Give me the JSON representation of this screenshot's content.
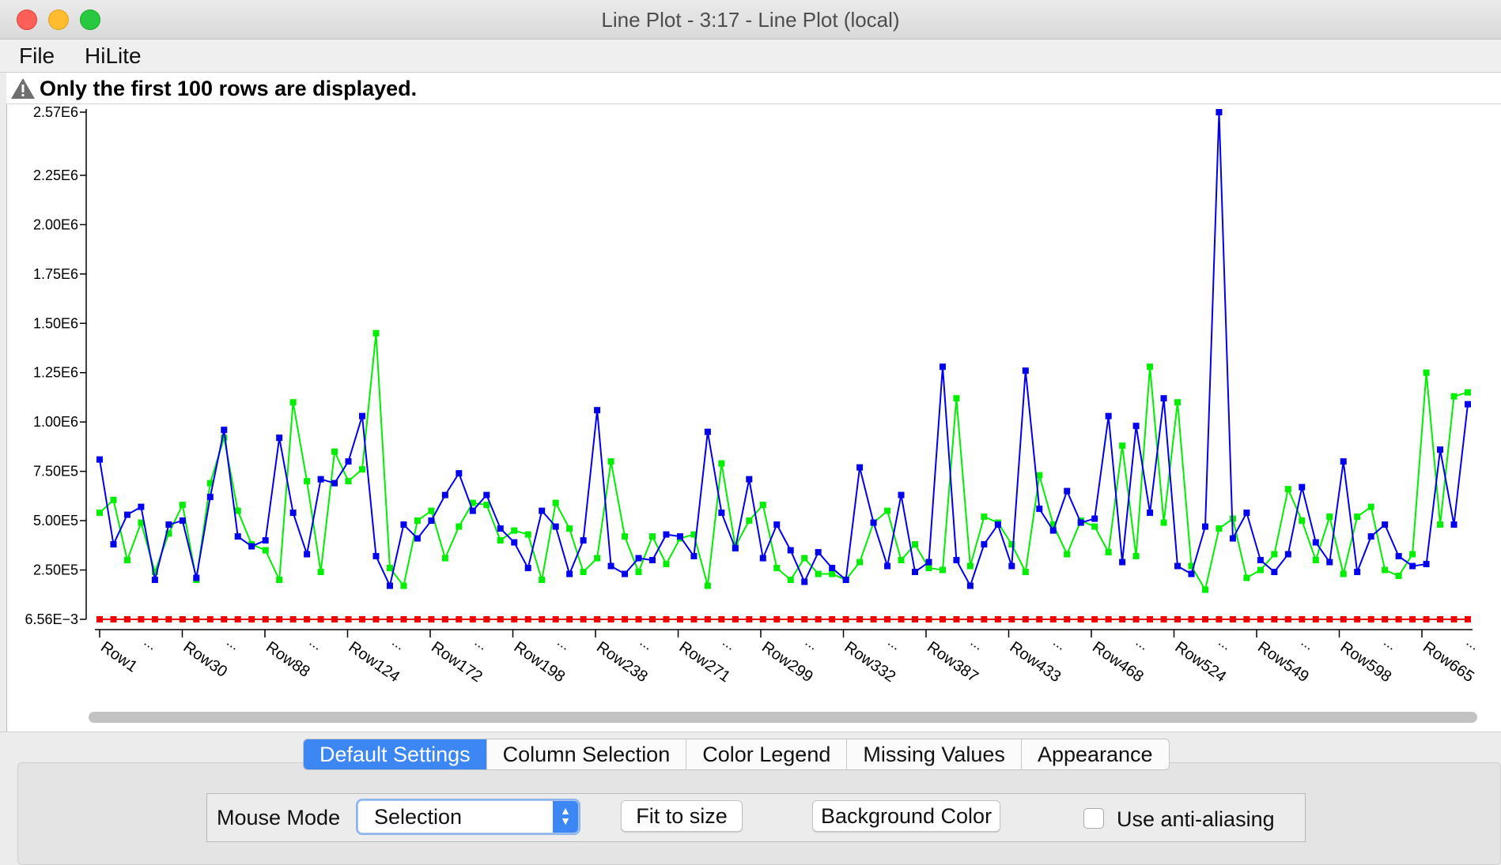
{
  "window": {
    "title": "Line Plot - 3:17 - Line Plot (local)"
  },
  "menu": [
    "File",
    "HiLite"
  ],
  "notice": {
    "text": "Only the first 100 rows are displayed.",
    "icon": "warning-icon"
  },
  "chart_data": {
    "type": "line",
    "title": "",
    "xlabel": "",
    "ylabel": "",
    "ylim": [
      0.00656,
      2570000
    ],
    "y_ticks": [
      "6.56E−3",
      "2.50E5",
      "5.00E5",
      "7.50E5",
      "1.00E6",
      "1.25E6",
      "1.50E6",
      "1.75E6",
      "2.00E6",
      "2.25E6",
      "2.57E6"
    ],
    "y_tick_values": [
      0.00656,
      250000,
      500000,
      750000,
      1000000,
      1250000,
      1500000,
      1750000,
      2000000,
      2250000,
      2570000
    ],
    "x_tick_labels": [
      "Row1",
      "Row30",
      "Row88",
      "Row124",
      "Row172",
      "Row198",
      "Row238",
      "Row271",
      "Row299",
      "Row332",
      "Row387",
      "Row433",
      "Row468",
      "Row524",
      "Row549",
      "Row598",
      "Row665"
    ],
    "x_elided_marker": "...",
    "point_count": 100,
    "grid": false,
    "series": [
      {
        "color": "#00ee00",
        "values": [
          540000,
          605000,
          300000,
          490000,
          240000,
          435000,
          580000,
          200000,
          690000,
          920000,
          550000,
          380000,
          350000,
          200000,
          1100000,
          700000,
          240000,
          850000,
          700000,
          760000,
          1450000,
          260000,
          170000,
          500000,
          550000,
          310000,
          470000,
          590000,
          580000,
          400000,
          450000,
          430000,
          200000,
          590000,
          460000,
          240000,
          310000,
          800000,
          420000,
          240000,
          420000,
          280000,
          410000,
          430000,
          170000,
          790000,
          370000,
          500000,
          580000,
          260000,
          200000,
          310000,
          230000,
          230000,
          200000,
          290000,
          490000,
          550000,
          300000,
          380000,
          260000,
          250000,
          1120000,
          270000,
          520000,
          490000,
          380000,
          240000,
          730000,
          480000,
          330000,
          500000,
          470000,
          340000,
          880000,
          320000,
          1280000,
          490000,
          1100000,
          270000,
          150000,
          460000,
          510000,
          210000,
          250000,
          330000,
          660000,
          500000,
          300000,
          520000,
          230000,
          520000,
          570000,
          250000,
          220000,
          330000,
          1250000,
          480000,
          1130000,
          1150000
        ]
      },
      {
        "color": "#0000ee",
        "values": [
          810000,
          380000,
          530000,
          570000,
          200000,
          480000,
          500000,
          210000,
          620000,
          960000,
          420000,
          370000,
          400000,
          920000,
          540000,
          330000,
          710000,
          690000,
          800000,
          1030000,
          320000,
          170000,
          480000,
          410000,
          500000,
          630000,
          740000,
          550000,
          630000,
          460000,
          390000,
          260000,
          550000,
          470000,
          230000,
          400000,
          1060000,
          270000,
          230000,
          310000,
          300000,
          430000,
          420000,
          320000,
          950000,
          540000,
          360000,
          710000,
          310000,
          480000,
          350000,
          190000,
          340000,
          260000,
          200000,
          770000,
          490000,
          270000,
          630000,
          240000,
          290000,
          1280000,
          300000,
          170000,
          380000,
          480000,
          270000,
          1260000,
          560000,
          450000,
          650000,
          490000,
          510000,
          1030000,
          290000,
          980000,
          540000,
          1120000,
          270000,
          230000,
          470000,
          2570000,
          410000,
          540000,
          300000,
          240000,
          330000,
          670000,
          390000,
          290000,
          800000,
          240000,
          420000,
          480000,
          320000,
          270000,
          280000,
          860000,
          480000,
          1090000
        ]
      },
      {
        "color": "#ee0000",
        "constant_value": 0.00656
      }
    ]
  },
  "tabs": [
    {
      "label": "Default Settings",
      "active": true
    },
    {
      "label": "Column Selection",
      "active": false
    },
    {
      "label": "Color Legend",
      "active": false
    },
    {
      "label": "Missing Values",
      "active": false
    },
    {
      "label": "Appearance",
      "active": false
    }
  ],
  "controls": {
    "mouse_mode_label": "Mouse Mode",
    "mouse_mode_value": "Selection",
    "fit_button": "Fit to size",
    "background_button": "Background Color",
    "anti_aliasing_label": "Use anti-aliasing",
    "anti_aliasing_checked": false
  }
}
